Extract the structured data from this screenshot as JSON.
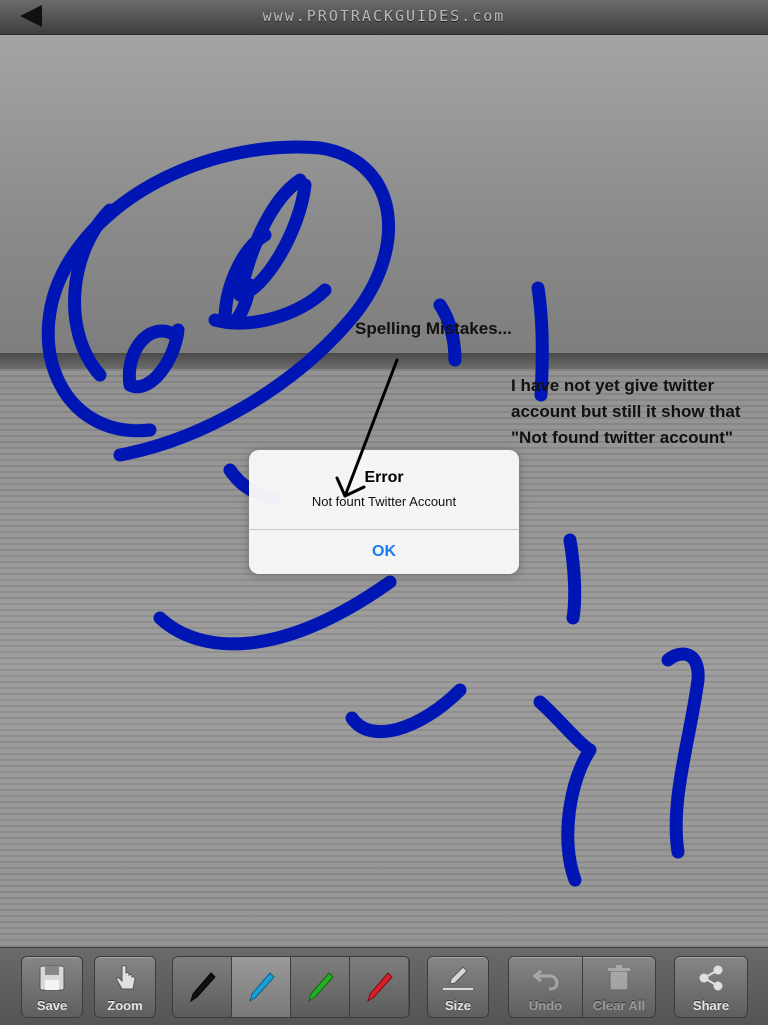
{
  "header": {
    "brand": "www.PROTRACKGUIDES.com",
    "back_icon": "back-arrow-icon"
  },
  "annotations": {
    "spelling": "Spelling Mistakes...",
    "info": "I have not yet give twitter account but still it show that \"Not found twitter account\""
  },
  "dialog": {
    "title": "Error",
    "message": "Not fount Twitter Account",
    "ok_label": "OK"
  },
  "toolbar": {
    "save": "Save",
    "zoom": "Zoom",
    "size": "Size",
    "undo": "Undo",
    "clear_all": "Clear All",
    "share": "Share",
    "pens": [
      {
        "name": "black-pen",
        "color": "#111111"
      },
      {
        "name": "blue-pen",
        "color": "#1aa0d8"
      },
      {
        "name": "green-pen",
        "color": "#22b022"
      },
      {
        "name": "red-pen",
        "color": "#d81e2a"
      }
    ]
  },
  "colors": {
    "ink": "#0016b4",
    "ok_blue": "#1a7cf5"
  }
}
